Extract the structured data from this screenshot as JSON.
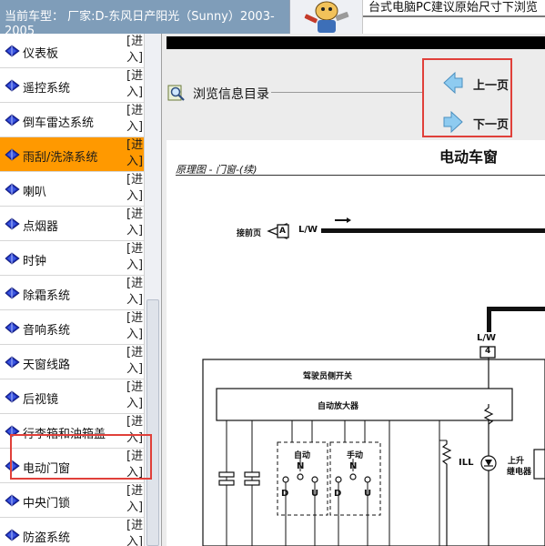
{
  "header": {
    "current_model_text": "当前车型： 厂家:D-东风日产阳光（Sunny）2003-2005",
    "banner_text": "台式电脑PC建议原始尺寸下浏览"
  },
  "sidebar": {
    "link_label": "[进入]",
    "active_index": 3,
    "items": [
      {
        "label": "仪表板"
      },
      {
        "label": "遥控系统"
      },
      {
        "label": "倒车雷达系统"
      },
      {
        "label": "雨刮/洗涤系统"
      },
      {
        "label": "喇叭"
      },
      {
        "label": "点烟器"
      },
      {
        "label": "时钟"
      },
      {
        "label": "除霜系统"
      },
      {
        "label": "音响系统"
      },
      {
        "label": "天窗线路"
      },
      {
        "label": "后视镜"
      },
      {
        "label": "行李箱和油箱盖"
      },
      {
        "label": "电动门窗"
      },
      {
        "label": "中央门锁"
      },
      {
        "label": "防盗系统"
      }
    ]
  },
  "toolbar": {
    "browse_label": "浏览信息目录",
    "prev_label": "上一页",
    "next_label": "下一页"
  },
  "diagram": {
    "title": "电动车窗",
    "subtitle": "原理图 - 门窗-(续)",
    "label_prev_page": "接前页",
    "connector_a": "A",
    "wire_lw_1": "L/W",
    "wire_lw_2": "L/W",
    "pin_4": "4",
    "driver_switch": "驾驶员侧开关",
    "auto_amp": "自动放大器",
    "auto": "自动",
    "manual": "手动",
    "n1": "N",
    "n2": "N",
    "d1": "D",
    "u1": "U",
    "d2": "D",
    "u2": "U",
    "ill": "ILL",
    "up_relay_1": "上升",
    "up_relay_2": "继电器"
  },
  "colors": {
    "header_bg": "#7f9db9",
    "active_item": "#ff9900",
    "highlight_border": "#e0403a",
    "nav_arrow": "#8ecbf0"
  }
}
